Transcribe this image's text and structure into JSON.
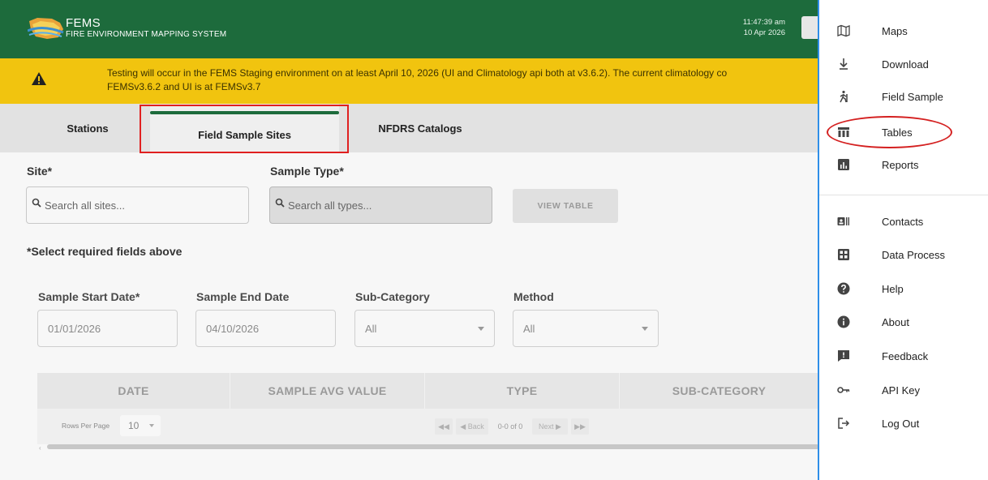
{
  "header": {
    "brand_title": "FEMS",
    "brand_subtitle": "FIRE ENVIRONMENT MAPPING SYSTEM",
    "time": "11:47:39 am",
    "date": "10 Apr 2026"
  },
  "banner": {
    "line1": "Testing will occur in the FEMS Staging environment on at least April 10, 2026 (UI and Climatology api both at v3.6.2). The current climatology co",
    "line2": "FEMSv3.6.2 and UI is at FEMSv3.7",
    "color": "#f1c40f"
  },
  "tabs": [
    {
      "label": "Stations"
    },
    {
      "label": "Field Sample Sites",
      "active": true
    },
    {
      "label": "NFDRS Catalogs"
    }
  ],
  "form": {
    "site_label": "Site*",
    "site_placeholder": "Search all sites...",
    "type_label": "Sample Type*",
    "type_placeholder": "Search all types...",
    "view_button": "VIEW TABLE",
    "required_note": "*Select required fields above",
    "start_label": "Sample Start Date*",
    "start_value": "01/01/2026",
    "end_label": "Sample End Date",
    "end_value": "04/10/2026",
    "subcat_label": "Sub-Category",
    "subcat_value": "All",
    "method_label": "Method",
    "method_value": "All"
  },
  "table": {
    "columns": [
      "DATE",
      "SAMPLE AVG VALUE",
      "TYPE",
      "SUB-CATEGORY"
    ],
    "rows_per_page_label": "Rows Per Page",
    "rows_per_page": "10",
    "first": "◀◀",
    "back": "◀ Back",
    "count": "0-0 of 0",
    "next": "Next ▶",
    "last": "▶▶",
    "scroll_left": "‹"
  },
  "menu": {
    "items": [
      {
        "label": "Maps",
        "icon": "map-icon"
      },
      {
        "label": "Download",
        "icon": "download-icon"
      },
      {
        "label": "Field Sample",
        "icon": "hiker-icon"
      },
      {
        "label": "Tables",
        "icon": "table-icon"
      },
      {
        "label": "Reports",
        "icon": "bar-chart-icon"
      },
      {
        "label": "Contacts",
        "icon": "contact-card-icon"
      },
      {
        "label": "Data Process",
        "icon": "grid-icon"
      },
      {
        "label": "Help",
        "icon": "help-icon"
      },
      {
        "label": "About",
        "icon": "info-icon"
      },
      {
        "label": "Feedback",
        "icon": "feedback-icon"
      },
      {
        "label": "API Key",
        "icon": "key-icon"
      },
      {
        "label": "Log Out",
        "icon": "logout-icon"
      }
    ],
    "accent": "#2f8ee8"
  },
  "colors": {
    "header": "#1d6b3c",
    "highlight": "#e02020"
  }
}
